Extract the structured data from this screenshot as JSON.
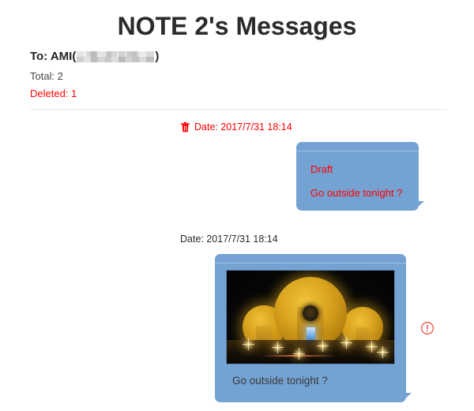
{
  "page": {
    "title": "NOTE 2's Messages"
  },
  "header": {
    "to_label": "To: AMI",
    "paren_open": "(",
    "paren_close": ")",
    "redacted_name": "",
    "total_line": "Total: 2",
    "deleted_line": "Deleted: 1"
  },
  "messages": [
    {
      "date_label": "Date: 2017/7/31 18:14",
      "deleted": true,
      "trash_icon": "trash-icon",
      "draft_label": "Draft",
      "text": "Go outside tonight ?",
      "has_image": false,
      "has_warning": false
    },
    {
      "date_label": "Date: 2017/7/31 18:14",
      "deleted": false,
      "text": "Go outside tonight ?",
      "has_image": true,
      "image_alt": "night-photo-golden-domes",
      "has_warning": true,
      "warning_icon": "exclamation-circle-icon"
    }
  ],
  "colors": {
    "bubble_blue": "#74a2d2",
    "bubble_top_line": "#9cc0e0",
    "deleted_red": "#ff0000",
    "title_dark": "#2b2b2b",
    "divider_gray": "#e6e6e6"
  }
}
